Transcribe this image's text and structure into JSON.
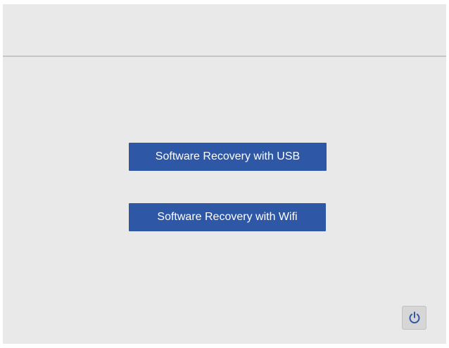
{
  "buttons": {
    "usb_label": "Software Recovery with USB",
    "wifi_label": "Software Recovery with Wifi"
  },
  "icons": {
    "power": "power-icon"
  },
  "colors": {
    "button_bg": "#2e58a6",
    "button_text": "#ffffff",
    "background": "#e9e9e9",
    "power_icon": "#2e58a6"
  }
}
